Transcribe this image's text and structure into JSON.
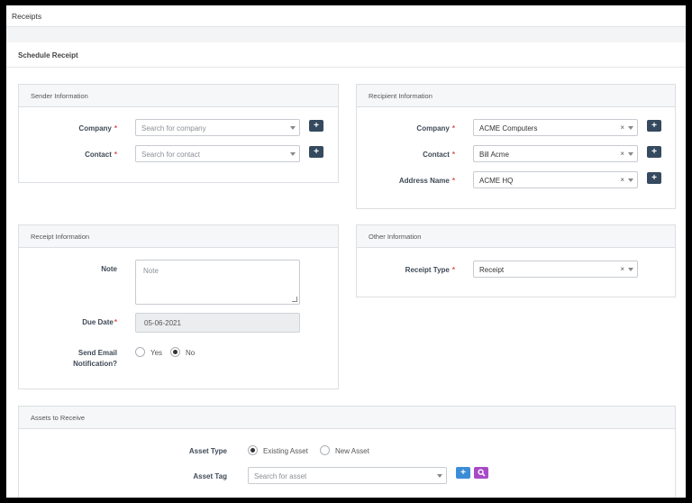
{
  "app": {
    "title": "Receipts"
  },
  "section": {
    "title": "Schedule Receipt"
  },
  "sender": {
    "title": "Sender Information",
    "company": {
      "label": "Company",
      "placeholder": "Search for company"
    },
    "contact": {
      "label": "Contact",
      "placeholder": "Search for contact"
    }
  },
  "recipient": {
    "title": "Recipient Information",
    "company": {
      "label": "Company",
      "value": "ACME Computers"
    },
    "contact": {
      "label": "Contact",
      "value": "Bill Acme"
    },
    "address": {
      "label": "Address Name",
      "value": "ACME HQ"
    }
  },
  "receipt_info": {
    "title": "Receipt Information",
    "note": {
      "label": "Note",
      "placeholder": "Note"
    },
    "due_date": {
      "label": "Due Date",
      "value": "05-06-2021"
    },
    "send_email": {
      "label_line1": "Send Email",
      "label_line2": "Notification?",
      "yes": "Yes",
      "no": "No",
      "selected": "No"
    }
  },
  "other_info": {
    "title": "Other Information",
    "receipt_type": {
      "label": "Receipt Type",
      "value": "Receipt"
    }
  },
  "assets": {
    "title": "Assets to Receive",
    "asset_type": {
      "label": "Asset Type",
      "options": [
        "Existing Asset",
        "New Asset"
      ],
      "selected": "Existing Asset"
    },
    "asset_tag": {
      "label": "Asset Tag",
      "placeholder": "Search for asset"
    }
  },
  "common": {
    "required_mark": "*",
    "plus": "+",
    "clear": "×"
  },
  "icons": {
    "add": "plus-icon",
    "search": "magnifier-icon",
    "dropdown": "caret-down-icon",
    "clear": "clear-x-icon"
  },
  "colors": {
    "add_button": "#354a5f",
    "blue_button": "#3c8dd6",
    "purple_button": "#a84ac7",
    "required": "#d9534f"
  }
}
